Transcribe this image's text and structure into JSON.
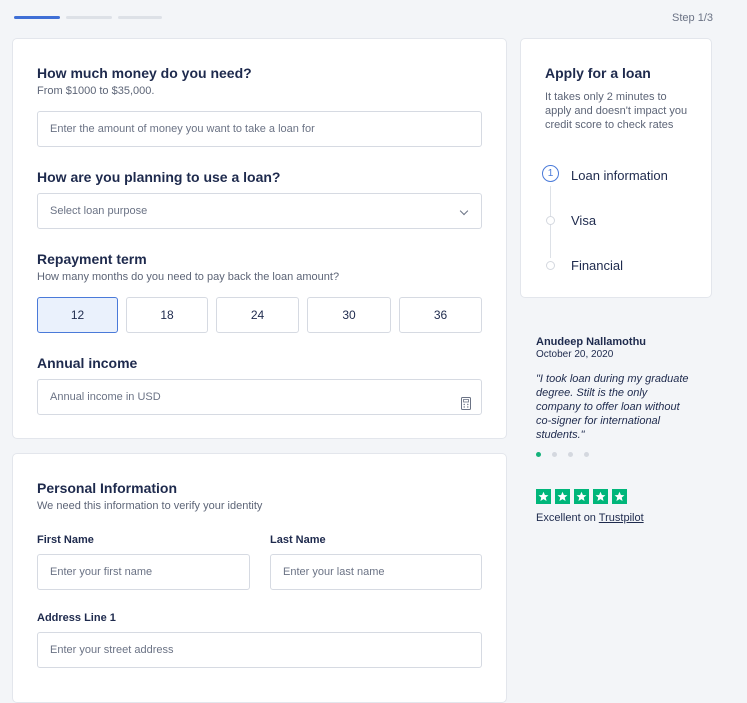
{
  "progress": {
    "step_text": "Step 1/3",
    "current_step": 1,
    "total_steps": 3
  },
  "loan_form": {
    "amount_heading": "How much money do you need?",
    "amount_range": "From $1000 to $35,000.",
    "amount_placeholder": "Enter the amount of money you want to take a loan for",
    "purpose_heading": "How are you planning to use a loan?",
    "purpose_placeholder": "Select loan purpose",
    "term_heading": "Repayment term",
    "term_sub": "How many months do you need to pay back the loan amount?",
    "term_options": [
      "12",
      "18",
      "24",
      "30",
      "36"
    ],
    "term_selected": "12",
    "income_heading": "Annual income",
    "income_placeholder": "Annual income in USD"
  },
  "personal": {
    "heading": "Personal Information",
    "sub": "We need this information to verify your identity",
    "first_label": "First Name",
    "first_placeholder": "Enter your first name",
    "last_label": "Last Name",
    "last_placeholder": "Enter your last name",
    "address_label": "Address Line 1",
    "address_placeholder": "Enter your street address"
  },
  "sidebar": {
    "title": "Apply for a loan",
    "description": "It takes only 2 minutes to apply and doesn't impact you credit score to check rates",
    "steps": [
      {
        "number": "1",
        "label": "Loan information"
      },
      {
        "label": "Visa"
      },
      {
        "label": "Financial"
      }
    ]
  },
  "testimonial": {
    "name": "Anudeep Nallamothu",
    "date": "October 20, 2020",
    "quote": "\"I took loan during my graduate degree. Stilt is the only company to offer loan without co-signer for international students.\"",
    "carousel_count": 4,
    "carousel_active": 1
  },
  "rating": {
    "stars": 5,
    "text_prefix": "Excellent on",
    "source": "Trustpilot",
    "star_color": "#00b67a"
  },
  "colors": {
    "accent": "#3f6fd6",
    "success": "#14b27b"
  }
}
